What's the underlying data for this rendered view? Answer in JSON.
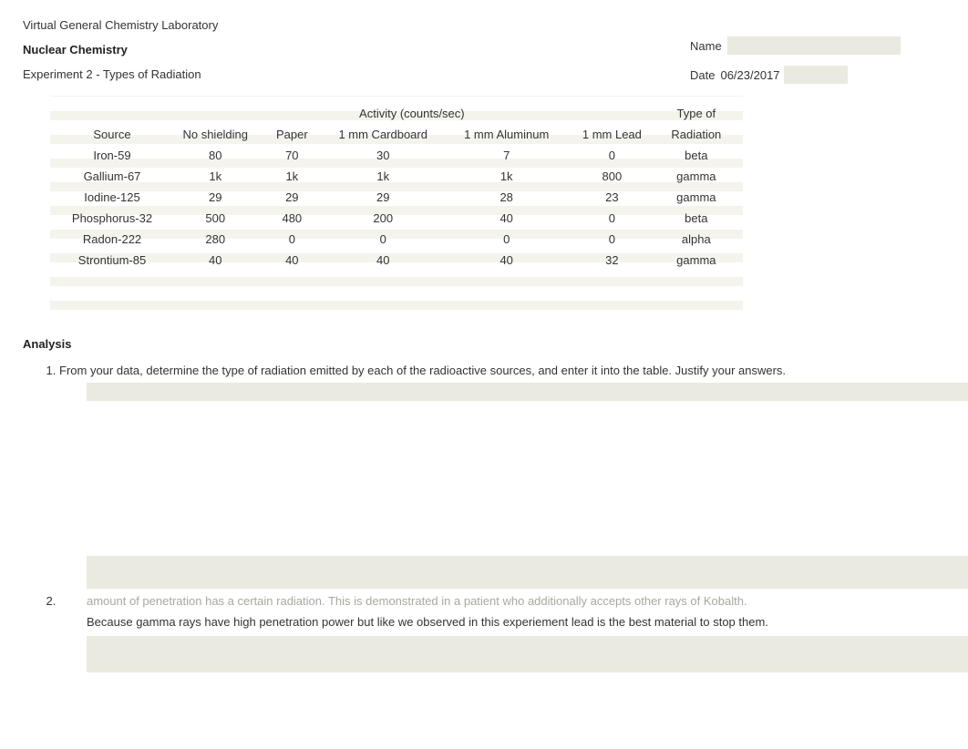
{
  "header": {
    "lab_title": "Virtual General Chemistry Laboratory",
    "course_title": "Nuclear Chemistry",
    "experiment_title": "Experiment 2 - Types of Radiation",
    "name_label": "Name",
    "name_value": "",
    "date_label": "Date",
    "date_value": "06/23/2017"
  },
  "table": {
    "col_source": "Source",
    "activity_header": "Activity (counts/sec)",
    "col_no_shield": "No shielding",
    "col_paper": "Paper",
    "col_cardboard": "1 mm Cardboard",
    "col_aluminum": "1 mm Aluminum",
    "col_lead": "1 mm Lead",
    "col_type_line1": "Type of",
    "col_type_line2": "Radiation",
    "rows": [
      {
        "source": "Iron-59",
        "no_shield": "80",
        "paper": "70",
        "cardboard": "30",
        "aluminum": "7",
        "lead": "0",
        "type": "beta"
      },
      {
        "source": "Gallium-67",
        "no_shield": "1k",
        "paper": "1k",
        "cardboard": "1k",
        "aluminum": "1k",
        "lead": "800",
        "type": "gamma"
      },
      {
        "source": "Iodine-125",
        "no_shield": "29",
        "paper": "29",
        "cardboard": "29",
        "aluminum": "28",
        "lead": "23",
        "type": "gamma"
      },
      {
        "source": "Phosphorus-32",
        "no_shield": "500",
        "paper": "480",
        "cardboard": "200",
        "aluminum": "40",
        "lead": "0",
        "type": "beta"
      },
      {
        "source": "Radon-222",
        "no_shield": "280",
        "paper": "0",
        "cardboard": "0",
        "aluminum": "0",
        "lead": "0",
        "type": "alpha"
      },
      {
        "source": "Strontium-85",
        "no_shield": "40",
        "paper": "40",
        "cardboard": "40",
        "aluminum": "40",
        "lead": "32",
        "type": "gamma"
      }
    ]
  },
  "analysis": {
    "title": "Analysis",
    "q1": "From your data, determine the type of radiation emitted by each of the radioactive sources, and enter it into the table. Justify your answers.",
    "q2_partial_faded": "amount of penetration has a certain radiation. This is demonstrated in a patient who additionally accepts other rays of Kobalth.",
    "q2_answer": "Because gamma rays have high penetration power but like we observed in this experiement lead is the best material to stop them."
  }
}
